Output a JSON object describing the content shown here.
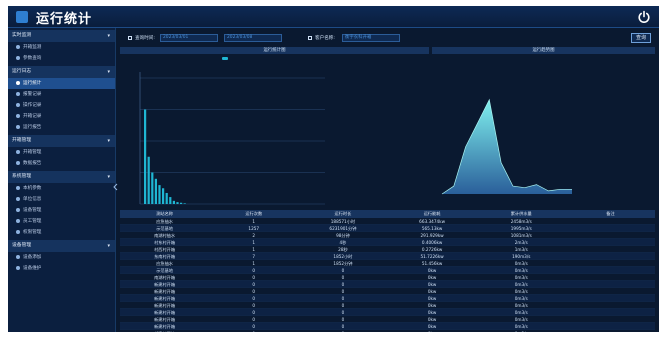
{
  "app": {
    "title": "运行统计"
  },
  "sidebar": {
    "sections": [
      {
        "label": "实时监测",
        "items": [
          {
            "label": "开箱监测",
            "active": false
          },
          {
            "label": "参数查询",
            "active": false
          }
        ]
      },
      {
        "label": "运行日志",
        "items": [
          {
            "label": "运行统计",
            "active": true
          },
          {
            "label": "报警记录",
            "active": false
          },
          {
            "label": "操作记录",
            "active": false
          },
          {
            "label": "开箱记录",
            "active": false
          },
          {
            "label": "运行报告",
            "active": false
          }
        ]
      },
      {
        "label": "开箱管理",
        "items": [
          {
            "label": "开箱管理",
            "active": false
          },
          {
            "label": "数据报告",
            "active": false
          }
        ]
      },
      {
        "label": "系统管理",
        "items": [
          {
            "label": "本机参数",
            "active": false
          },
          {
            "label": "单位信息",
            "active": false
          },
          {
            "label": "设备管理",
            "active": false
          },
          {
            "label": "员工管理",
            "active": false
          },
          {
            "label": "权限管理",
            "active": false
          }
        ]
      },
      {
        "label": "设备管理",
        "items": [
          {
            "label": "设备添加",
            "active": false
          },
          {
            "label": "设备维护",
            "active": false
          }
        ]
      }
    ]
  },
  "filter": {
    "date_label": "查询时间:",
    "date_from": "2023/03/01",
    "date_to": "2023/03/08",
    "client_label": "客户名称:",
    "client_value": "衡宇农科开箱",
    "query_button": "查询"
  },
  "panels": {
    "left_title": "运行统计图",
    "right_title": "运行趋势图"
  },
  "chart_data": [
    {
      "type": "bar",
      "title": "运行统计图",
      "values": [
        300,
        150,
        100,
        80,
        60,
        50,
        35,
        22,
        10,
        6,
        4,
        2
      ],
      "ylim": [
        0,
        400
      ],
      "grid": true
    },
    {
      "type": "area",
      "title": "运行趋势图",
      "values": [
        0,
        5,
        30,
        45,
        60,
        20,
        5,
        4,
        6,
        2,
        3,
        3
      ],
      "ylim": [
        0,
        70
      ],
      "grid": false
    }
  ],
  "table": {
    "columns": [
      "测站名称",
      "运行次数",
      "运行时长",
      "运行能耗",
      "累计供水量",
      "备注"
    ],
    "rows": [
      [
        "应急抽水",
        "1",
        "188571小时",
        "663.3474kw",
        "2458m3/s",
        ""
      ],
      [
        "示范基地",
        "1257",
        "6231901分钟",
        "565.13kw",
        "1995m3/s",
        ""
      ],
      [
        "南湖村抽水",
        "2",
        "98分钟",
        "291.929kw",
        "1081m3/s",
        ""
      ],
      [
        "村东村开箱",
        "1",
        "4秒",
        "0.4006kw",
        "2m3/s",
        ""
      ],
      [
        "村西村开箱",
        "1",
        "28秒",
        "0.2726kw",
        "1m3/s",
        ""
      ],
      [
        "东南村开箱",
        "7",
        "1852小时",
        "51.7226kw",
        "190m3/s",
        ""
      ],
      [
        "应急抽水",
        "1",
        "1852分钟",
        "51.456kw",
        "0m3/s",
        ""
      ],
      [
        "示范基地",
        "0",
        "0",
        "0kw",
        "0m3/s",
        ""
      ],
      [
        "南湖村开箱",
        "0",
        "0",
        "0kw",
        "0m3/s",
        ""
      ],
      [
        "新建村开箱",
        "0",
        "0",
        "0kw",
        "0m3/s",
        ""
      ],
      [
        "新建村开箱",
        "0",
        "0",
        "0kw",
        "0m3/s",
        ""
      ],
      [
        "新建村开箱",
        "0",
        "0",
        "0kw",
        "0m3/s",
        ""
      ],
      [
        "新建村开箱",
        "0",
        "0",
        "0kw",
        "0m3/s",
        ""
      ],
      [
        "新建村开箱",
        "0",
        "0",
        "0kw",
        "0m3/s",
        ""
      ],
      [
        "新建村开箱",
        "0",
        "0",
        "0kw",
        "0m3/s",
        ""
      ],
      [
        "新建村开箱",
        "0",
        "0",
        "0kw",
        "0m3/s",
        ""
      ],
      [
        "新建村开箱",
        "0",
        "0",
        "0kw",
        "0m3/s",
        ""
      ]
    ]
  }
}
